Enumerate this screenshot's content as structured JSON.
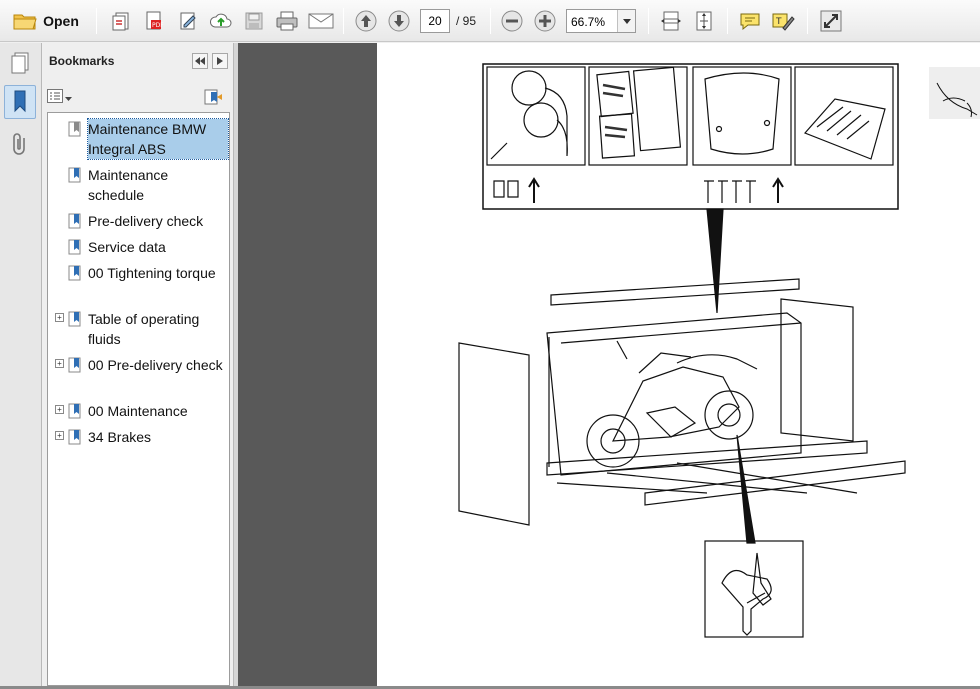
{
  "toolbar": {
    "open_label": "Open",
    "page_current": "20",
    "page_total": "/ 95",
    "zoom": "66.7%",
    "icons": [
      "open-folder-icon",
      "create-pdf-icon",
      "export-pdf-icon",
      "sign-icon",
      "upload-cloud-icon",
      "save-icon",
      "print-icon",
      "email-icon",
      "prev-page-icon",
      "next-page-icon",
      "zoom-out-icon",
      "zoom-in-icon",
      "fit-width-icon",
      "fit-page-icon",
      "comment-icon",
      "highlight-text-icon",
      "full-screen-icon"
    ]
  },
  "left_strip": {
    "icons": [
      "page-thumbnails-icon",
      "bookmarks-icon",
      "attachments-icon"
    ]
  },
  "bookmarks": {
    "title": "Bookmarks",
    "items": [
      {
        "label": "Maintenance BMW Integral ABS",
        "expandable": false,
        "selected": true
      },
      {
        "label": "Maintenance schedule",
        "expandable": false,
        "selected": false
      },
      {
        "label": "Pre-delivery check",
        "expandable": false,
        "selected": false
      },
      {
        "label": "Service data",
        "expandable": false,
        "selected": false
      },
      {
        "label": "00 Tightening torque",
        "expandable": false,
        "selected": false
      },
      {
        "label": "Table of operating fluids",
        "expandable": true,
        "selected": false
      },
      {
        "label": "00 Pre-delivery check",
        "expandable": true,
        "selected": false
      },
      {
        "label": "00 Maintenance",
        "expandable": true,
        "selected": false
      },
      {
        "label": "34 Brakes",
        "expandable": true,
        "selected": false
      }
    ]
  },
  "colors": {
    "doc_background": "#595959",
    "selection": "#a9cdea",
    "panel": "#efefef"
  }
}
